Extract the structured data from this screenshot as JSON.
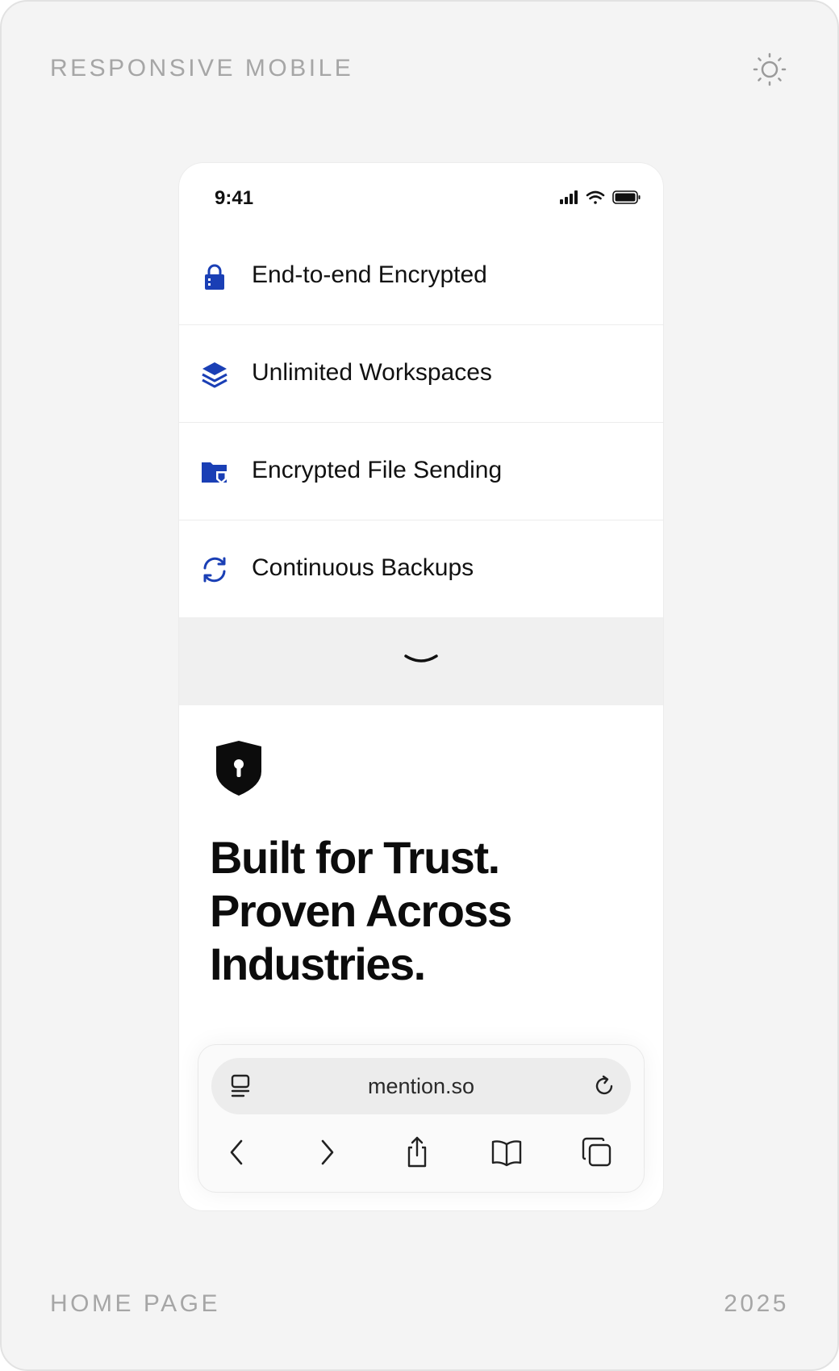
{
  "frame": {
    "top_left_label": "RESPONSIVE MOBILE",
    "bottom_left_label": "HOME PAGE",
    "bottom_right_label": "2025",
    "theme_icon": "sun-icon"
  },
  "status_bar": {
    "time": "9:41",
    "icons": [
      "signal-icon",
      "wifi-icon",
      "battery-icon"
    ]
  },
  "features": [
    {
      "label": "End-to-end Encrypted",
      "icon": "lock-icon"
    },
    {
      "label": "Unlimited Workspaces",
      "icon": "layers-icon"
    },
    {
      "label": "Encrypted File Sending",
      "icon": "folder-shield-icon"
    },
    {
      "label": "Continuous Backups",
      "icon": "sync-icon"
    }
  ],
  "expand_icon": "chevron-down-icon",
  "hero": {
    "icon": "shield-keyhole-icon",
    "headline_lines": [
      "Built for Trust.",
      "Proven Across",
      "Industries."
    ]
  },
  "browser": {
    "url": "mention.so",
    "left_icon": "tab-overview-icon",
    "right_icon": "reload-icon",
    "toolbar": [
      "back-icon",
      "forward-icon",
      "share-icon",
      "bookmarks-icon",
      "tabs-icon"
    ]
  },
  "colors": {
    "accent": "#1a3fb5",
    "background": "#f4f4f4",
    "phone": "#ffffff",
    "muted_label": "#a6a6a6"
  }
}
